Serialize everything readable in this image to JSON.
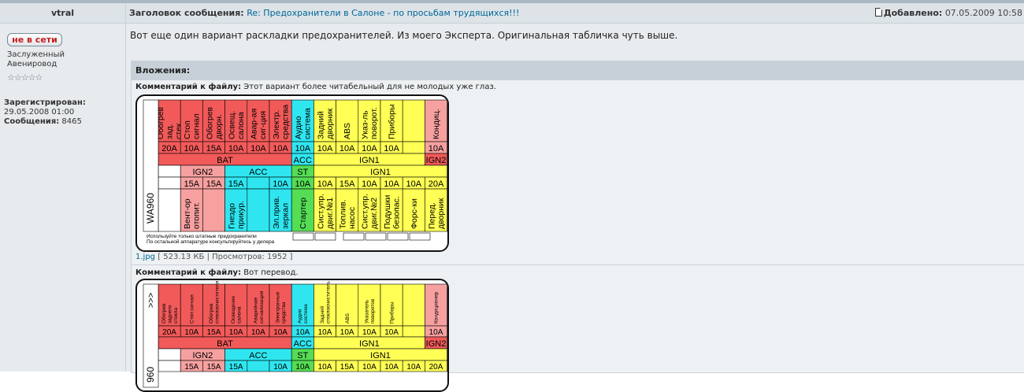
{
  "author": {
    "name": "vtral",
    "status_button": "не в сети",
    "rank_line1": "Заслуженный",
    "rank_line2": "Авенировод",
    "stars": "☆☆☆☆☆",
    "registered_label": "Зарегистрирован:",
    "registered_value": "29.05.2008 01:00",
    "messages_label": "Сообщения:",
    "messages_value": "8465"
  },
  "message": {
    "subject_label": "Заголовок сообщения:",
    "subject": "Re: Предохранители в Салоне - по просьбам трудящихся!!!",
    "added_label": "Добавлено:",
    "added_value": "07.05.2009 10:58",
    "body": "Вот еще один вариант раскладки предохранителей. Из моего Эксперта. Оригинальная табличка чуть выше."
  },
  "attachments": {
    "title": "Вложения:",
    "comment_label": "Комментарий к файлу:",
    "files": [
      {
        "comment": "Этот вариант более читабельный для не молодых уже глаз.",
        "filename": "1.jpg",
        "size": "523.13 КБ",
        "views_label": "Просмотров:",
        "views": "1952"
      },
      {
        "comment": "Вот перевод."
      }
    ]
  },
  "fuse_tables": [
    {
      "model_code": "WA960",
      "note_line1": "Используйте только штатные предохранители",
      "note_line2": "По остальной аппаратуре консультируйтесь у дилера",
      "top_labels": [
        "Обогрев зад. стек.",
        "Стоп сигнал",
        "Обогрев дворн.",
        "Освещ. салона",
        "Авар-ая сиг-ция",
        "Электр. средства",
        "Аудио система",
        "Задний дворник",
        "ABS",
        "Указ-ль поворот.",
        "Приборы",
        "",
        "Кондиц."
      ],
      "top_amps": [
        "20A",
        "10A",
        "15A",
        "10A",
        "10A",
        "10A",
        "10A",
        "10A",
        "10A",
        "10A",
        "10A",
        "",
        "10A"
      ],
      "band_top": [
        "BAT",
        "ACC",
        "IGN1",
        "IGN2"
      ],
      "band_bottom": [
        "IGN2",
        "ACC",
        "ST",
        "IGN1"
      ],
      "bottom_amps": [
        "",
        "15A",
        "15A",
        "15A",
        "",
        "10A",
        "10A",
        "10A",
        "15A",
        "10A",
        "10A",
        "10A",
        "20A"
      ],
      "bottom_labels": [
        "",
        "Вент-ор отопит.",
        "",
        "Гнездо прикур.",
        "",
        "Эл.прив. зеркал",
        "Стартер",
        "Сист.упр. двиг.№1",
        "Топлив. насос",
        "Сист.упр. двиг.№2",
        "Подушки безопас.",
        "Форс-ки",
        "Перед. дворник"
      ]
    },
    {
      "model_code": "960",
      "arrow_text": ">>>",
      "top_labels": [
        "Обогрев заднего стекла",
        "Стоп сигнал",
        "Обогрев стеклоочистителя",
        "Освещение салона",
        "Аварийная сигнализация",
        "Электронные средства",
        "Аудио система",
        "Задний стеклоочиститель",
        "ABS",
        "Указатель поворотов",
        "Приборы",
        "",
        "Кондиционер"
      ],
      "top_amps": [
        "20A",
        "10A",
        "15A",
        "10A",
        "10A",
        "10A",
        "10A",
        "10A",
        "10A",
        "10A",
        "10A",
        "",
        "10A"
      ],
      "band_top": [
        "BAT",
        "ACC",
        "IGN1",
        "IGN2"
      ],
      "band_bottom": [
        "IGN2",
        "ACC",
        "ST",
        "IGN1"
      ],
      "bottom_amps": [
        "",
        "15A",
        "15A",
        "15A",
        "",
        "10A",
        "10A",
        "10A",
        "15A",
        "10A",
        "10A",
        "10A",
        "20A"
      ]
    }
  ],
  "colors": {
    "red": "#f25a5a",
    "red_light": "#f7a0a0",
    "cyan": "#2fe6f0",
    "yellow": "#ffff55",
    "green": "#55dd55",
    "link": "#006699"
  }
}
